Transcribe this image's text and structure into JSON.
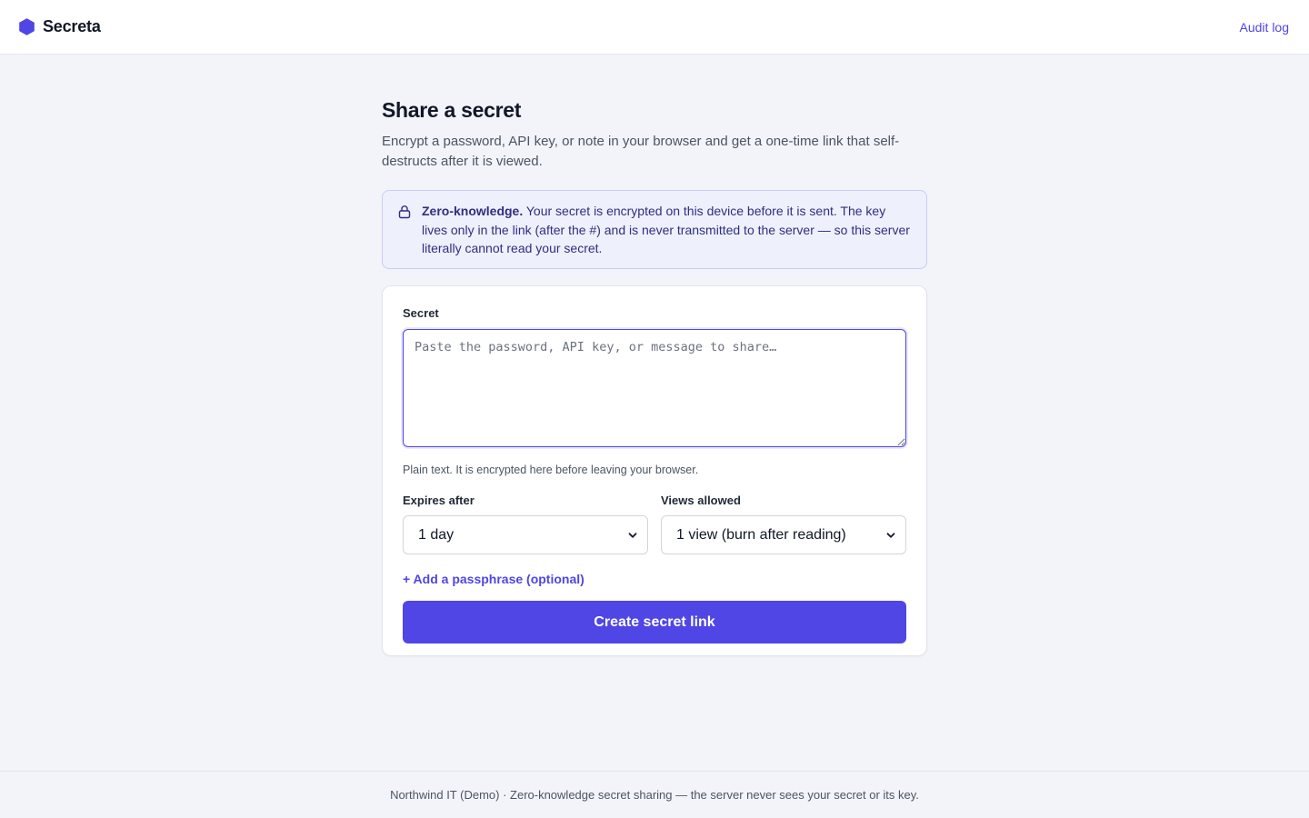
{
  "header": {
    "brand_name": "Secreta",
    "logo_icon": "hexagon-icon",
    "audit_link": "Audit log"
  },
  "page": {
    "title": "Share a secret",
    "subtitle": "Encrypt a password, API key, or note in your browser and get a one-time link that self-destructs after it is viewed."
  },
  "notice": {
    "icon": "lock-icon",
    "title": "Zero-knowledge.",
    "body": "Your secret is encrypted on this device before it is sent. The key lives only in the link (after the #) and is never transmitted to the server — so this server literally cannot read your secret."
  },
  "form": {
    "secret_label": "Secret",
    "secret_placeholder": "Paste the password, API key, or message to share…",
    "secret_value": "",
    "secret_hint": "Plain text. It is encrypted here before leaving your browser.",
    "expires_label": "Expires after",
    "expires_value": "1 day",
    "views_label": "Views allowed",
    "views_value": "1 view (burn after reading)",
    "passphrase_link": "+ Add a passphrase (optional)",
    "submit_label": "Create secret link"
  },
  "footer": {
    "text": "Northwind IT (Demo) · Zero-knowledge secret sharing — the server never sees your secret or its key."
  },
  "colors": {
    "accent": "#4f46e5",
    "background": "#f3f4f9",
    "notice_bg": "#eef0fc",
    "notice_text": "#312e81"
  }
}
